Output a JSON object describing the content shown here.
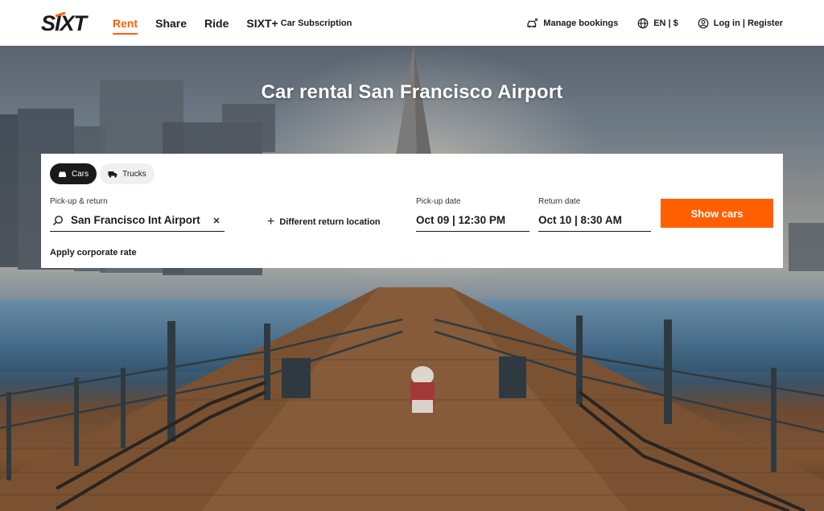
{
  "brand": {
    "logo_text": "SIXT",
    "accent": "#ff5f00"
  },
  "nav": {
    "items": [
      {
        "label": "Rent",
        "active": true
      },
      {
        "label": "Share",
        "active": false
      },
      {
        "label": "Ride",
        "active": false
      },
      {
        "label": "SIXT+",
        "sub": "Car Subscription",
        "active": false
      }
    ]
  },
  "header_right": {
    "manage": {
      "label": "Manage bookings",
      "icon": "car-booking-icon"
    },
    "locale": {
      "label": "EN | $",
      "icon": "globe-icon"
    },
    "account": {
      "label": "Log in | Register",
      "icon": "user-icon"
    }
  },
  "hero": {
    "title": "Car rental San Francisco Airport"
  },
  "booking": {
    "tabs": [
      {
        "label": "Cars",
        "active": true,
        "icon": "car-icon"
      },
      {
        "label": "Trucks",
        "active": false,
        "icon": "truck-icon"
      }
    ],
    "pickup_return": {
      "label": "Pick-up & return",
      "value": "San Francisco Int Airport"
    },
    "different_return": "Different return location",
    "pickup_date": {
      "label": "Pick-up date",
      "value": "Oct 09 | 12:30 PM"
    },
    "return_date": {
      "label": "Return date",
      "value": "Oct 10 | 8:30 AM"
    },
    "show_cars": "Show cars",
    "corporate": "Apply corporate rate"
  }
}
